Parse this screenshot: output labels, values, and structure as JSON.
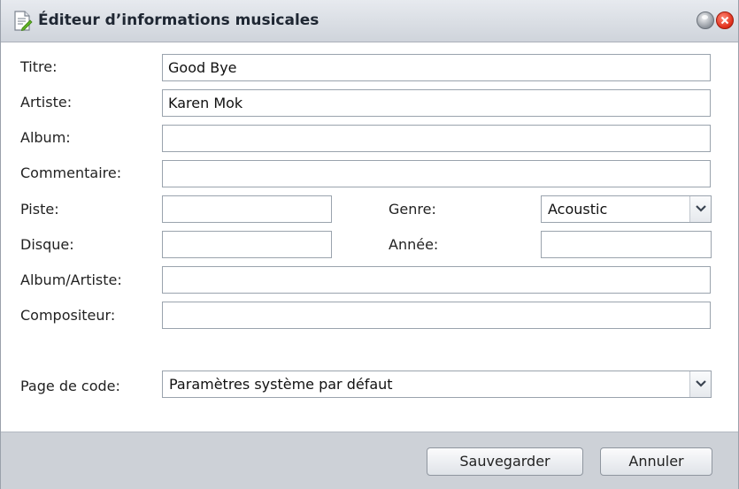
{
  "window": {
    "title": "Éditeur d’informations musicales",
    "icons": {
      "title": "document-edit-icon",
      "help": "help-button-icon",
      "close": "close-icon"
    }
  },
  "form": {
    "titre": {
      "label": "Titre:",
      "value": "Good Bye"
    },
    "artiste": {
      "label": "Artiste:",
      "value": "Karen Mok"
    },
    "album": {
      "label": "Album:",
      "value": ""
    },
    "commentaire": {
      "label": "Commentaire:",
      "value": ""
    },
    "piste": {
      "label": "Piste:",
      "value": ""
    },
    "genre": {
      "label": "Genre:",
      "value": "Acoustic"
    },
    "disque": {
      "label": "Disque:",
      "value": ""
    },
    "annee": {
      "label": "Année:",
      "value": ""
    },
    "album_artiste": {
      "label": "Album/Artiste:",
      "value": ""
    },
    "compositeur": {
      "label": "Compositeur:",
      "value": ""
    },
    "page_de_code": {
      "label": "Page de code:",
      "value": "Paramètres système par défaut"
    }
  },
  "buttons": {
    "save": "Sauvegarder",
    "cancel": "Annuler"
  },
  "colors": {
    "titlebar": "#d6dae0",
    "footer": "#cdd1d7",
    "close": "#e2321e"
  }
}
